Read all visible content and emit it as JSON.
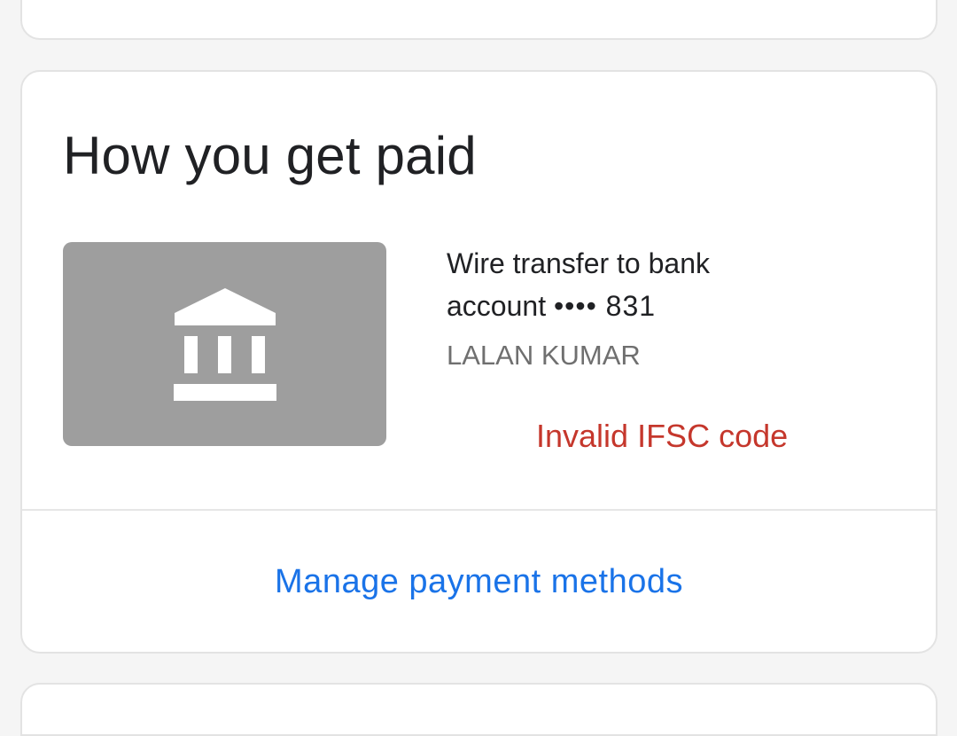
{
  "section": {
    "title": "How you get paid"
  },
  "payment_method": {
    "icon": "bank-icon",
    "line1": "Wire transfer to bank",
    "line2_prefix": "account",
    "masked_account": "•••• 831",
    "holder_name": "LALAN KUMAR",
    "error": "Invalid IFSC code"
  },
  "actions": {
    "manage_label": "Manage payment methods"
  },
  "colors": {
    "title_text": "#202124",
    "secondary_text": "#6f6f6f",
    "error": "#c5372c",
    "link": "#1a73e8",
    "icon_tile": "#9e9e9e"
  }
}
